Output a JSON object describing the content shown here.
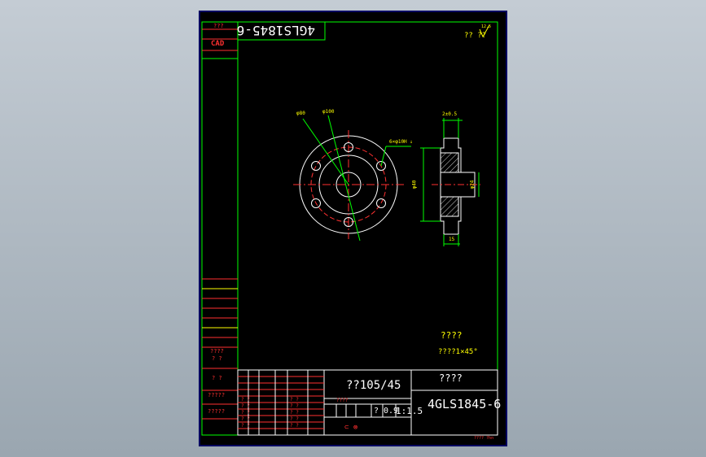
{
  "drawing": {
    "part_number": "4GLS1845-6",
    "part_number_rotated": "4GLS1845-6",
    "material": "??105/45",
    "part_name": "????",
    "ratio": "1:1.5",
    "sheet_info": "0.9",
    "roughness_symbol": "12.5",
    "roughness_note": "?? ??",
    "tech_req_title": "????",
    "tech_req_note": "????1×45°",
    "footer_code": "???? ?hn"
  },
  "sidebar": {
    "top_label": "???",
    "cad_label": "CAD",
    "label_a": "????",
    "label_b": "? ?",
    "label_c": "? ?",
    "label_d": "?????",
    "label_e": "?????"
  },
  "dimensions": {
    "circle_pcd": "φ80",
    "circle_outer": "φ100",
    "holes": "6×φ10H ↓",
    "thickness_top": "2±0.5",
    "side_height": "φ40",
    "side_bore": "φ24",
    "side_bottom": "15"
  },
  "title_block": {
    "grid_cells": [
      "? ?",
      "? ?",
      "? ?",
      "? ?",
      "? ?",
      "? ?",
      "? ?",
      "? ?",
      "? ?",
      "? ?"
    ],
    "scale_label": "????",
    "count": "?"
  },
  "colors": {
    "paper": "#000000",
    "frame": "#00ff00",
    "text_yellow": "#ffff00",
    "text_red": "#ff3030",
    "geometry": "#ffffff"
  }
}
